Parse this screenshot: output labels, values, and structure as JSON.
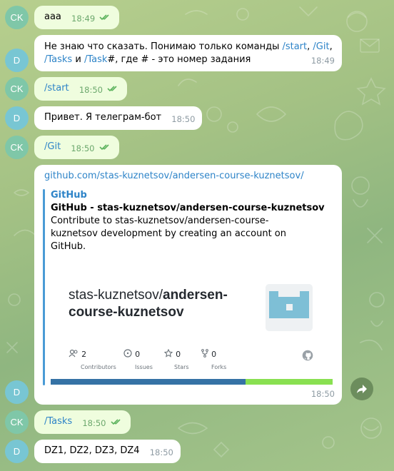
{
  "messages": [
    {
      "avatar": "CK",
      "text": "aaa",
      "time": "18:49"
    },
    {
      "avatar": "D",
      "parts": [
        "Не знаю что сказать. Понимаю только команды ",
        "/start",
        ", ",
        "/Git",
        ",",
        "/Tasks",
        " и ",
        "/Task",
        "#, где # - это номер задания"
      ],
      "time": "18:49"
    },
    {
      "avatar": "CK",
      "text": "/start",
      "time": "18:50"
    },
    {
      "avatar": "D",
      "text": "Привет. Я телеграм-бот",
      "time": "18:50"
    },
    {
      "avatar": "CK",
      "text": "/Git",
      "time": "18:50"
    },
    {
      "avatar": "D",
      "link": "github.com/stas-kuznetsov/andersen-course-kuznetsov/",
      "preview": {
        "site": "GitHub",
        "title": "GitHub - stas-kuznetsov/andersen-course-kuznetsov",
        "description": "Contribute to stas-kuznetsov/andersen-course-kuznetsov development by creating an account on GitHub.",
        "card_repo_owner": "stas-kuznetsov/",
        "card_repo_name_1": "andersen-",
        "card_repo_name_2": "course-kuznetsov",
        "stats": [
          {
            "icon": "contributors-icon",
            "value": "2",
            "label": "Contributors"
          },
          {
            "icon": "issues-icon",
            "value": "0",
            "label": "Issues"
          },
          {
            "icon": "stars-icon",
            "value": "0",
            "label": "Stars"
          },
          {
            "icon": "forks-icon",
            "value": "0",
            "label": "Forks"
          }
        ],
        "language_bar_colors": [
          "#3572a5",
          "#89e051"
        ]
      },
      "time": "18:50"
    },
    {
      "avatar": "CK",
      "text": "/Tasks",
      "time": "18:50"
    },
    {
      "avatar": "D",
      "text": "DZ1, DZ2, DZ3, DZ4",
      "time": "18:50"
    }
  ],
  "colors": {
    "outgoing_bubble": "#effdde",
    "incoming_bubble": "#ffffff",
    "link": "#2e84c8",
    "avatar_ck": "#7fc7a8",
    "avatar_d": "#78c6d3"
  }
}
